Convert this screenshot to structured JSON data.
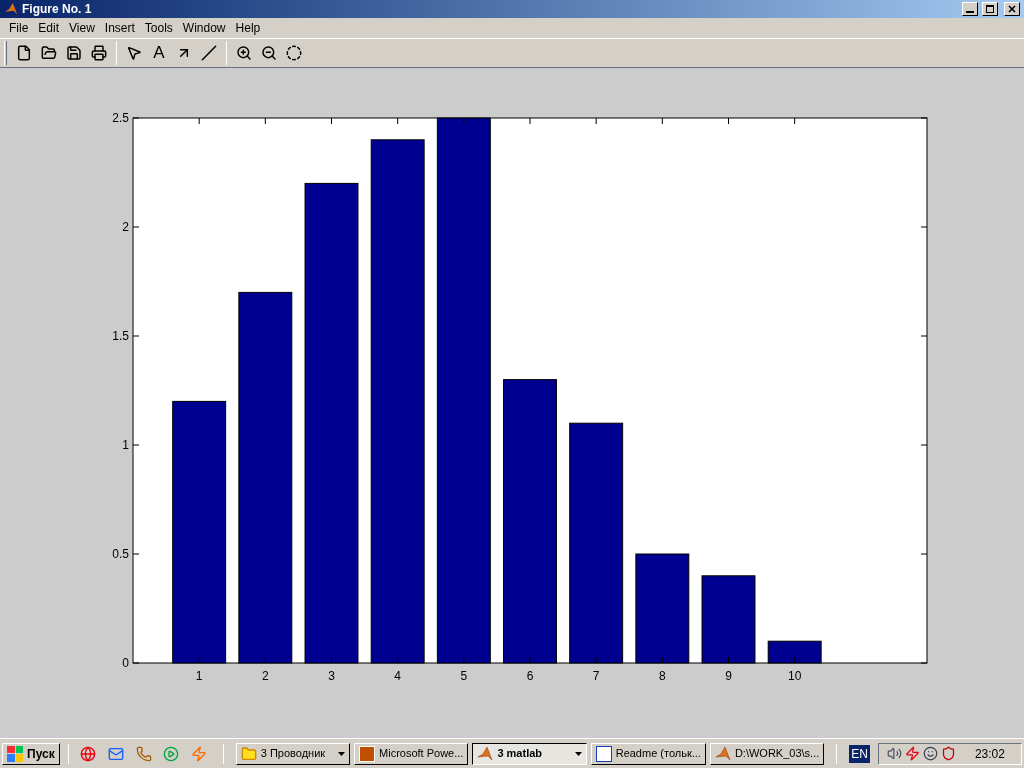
{
  "window": {
    "title": "Figure No. 1"
  },
  "menu": [
    "File",
    "Edit",
    "View",
    "Insert",
    "Tools",
    "Window",
    "Help"
  ],
  "toolbar": [
    {
      "kind": "new"
    },
    {
      "kind": "open"
    },
    {
      "kind": "save"
    },
    {
      "kind": "print"
    },
    {
      "kind": "sep"
    },
    {
      "kind": "pointer"
    },
    {
      "kind": "text",
      "label": "A"
    },
    {
      "kind": "arrow"
    },
    {
      "kind": "line"
    },
    {
      "kind": "sep"
    },
    {
      "kind": "zoomin"
    },
    {
      "kind": "zoomout"
    },
    {
      "kind": "rotate"
    }
  ],
  "figure": {
    "chart_data": {
      "type": "bar",
      "categories": [
        "1",
        "2",
        "3",
        "4",
        "5",
        "6",
        "7",
        "8",
        "9",
        "10"
      ],
      "series": [
        {
          "color": "#000090",
          "values": [
            1.2,
            1.7,
            2.2,
            2.4,
            2.5,
            1.3,
            1.1,
            0.5,
            0.4,
            0.1
          ]
        }
      ],
      "ylim": [
        0,
        2.5
      ],
      "yticks": [
        0,
        {
          "value": 0.5,
          "label": "0.5"
        },
        1,
        {
          "value": 1.5,
          "label": "1.5"
        },
        2,
        {
          "value": 2.5,
          "label": "2.5"
        }
      ]
    }
  },
  "taskbar": {
    "start": "Пуск",
    "quicklaunch": [
      {
        "kind": "opera"
      },
      {
        "kind": "outlook"
      },
      {
        "kind": "phone"
      },
      {
        "kind": "media"
      },
      {
        "kind": "winamp"
      }
    ],
    "tasks": [
      {
        "kind": "folder",
        "label": "3 Проводник",
        "selected": false,
        "grouped": true
      },
      {
        "kind": "slides",
        "label": "Microsoft Powe...",
        "selected": false,
        "grouped": false
      },
      {
        "kind": "matlab",
        "label": "3 matlab",
        "selected": true,
        "grouped": true
      },
      {
        "kind": "word",
        "label": "Readme (тольк...",
        "selected": false,
        "grouped": false
      },
      {
        "kind": "matlab",
        "label": "D:\\WORK_03\\s...",
        "selected": false,
        "grouped": false
      }
    ],
    "language": "EN",
    "tray": [
      {
        "kind": "speaker"
      },
      {
        "kind": "antivirus"
      },
      {
        "kind": "clockface"
      },
      {
        "kind": "shield"
      }
    ],
    "clock": "23:02"
  }
}
